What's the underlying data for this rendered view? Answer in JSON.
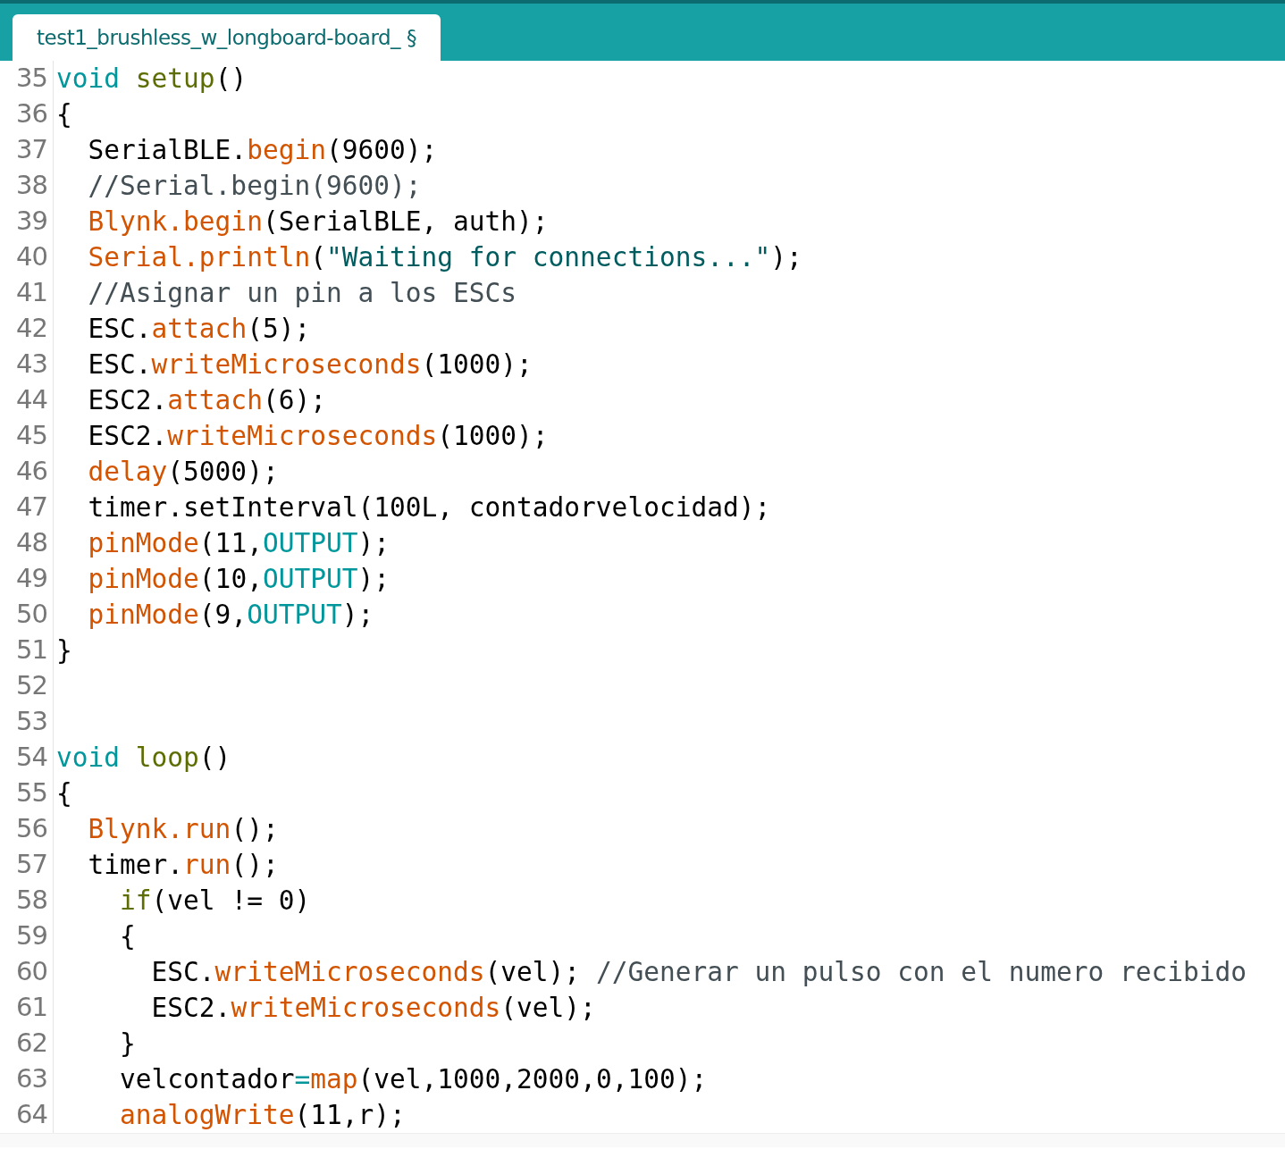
{
  "tabs": [
    {
      "label": "test1_brushless_w_longboard-board_ §",
      "selected": true
    }
  ],
  "lines": [
    {
      "number": "35",
      "tokens": [
        {
          "kind": "keyword",
          "text": "void"
        },
        {
          "kind": "name",
          "text": " setup"
        },
        {
          "kind": "plain",
          "text": "()"
        }
      ]
    },
    {
      "number": "36",
      "tokens": [
        {
          "kind": "plain",
          "text": "{"
        }
      ]
    },
    {
      "number": "37",
      "tokens": [
        {
          "kind": "plain",
          "text": "  SerialBLE."
        },
        {
          "kind": "function",
          "text": "begin"
        },
        {
          "kind": "plain",
          "text": "(9600);"
        }
      ]
    },
    {
      "number": "38",
      "tokens": [
        {
          "kind": "comment",
          "text": "  //Serial.begin(9600);"
        }
      ]
    },
    {
      "number": "39",
      "tokens": [
        {
          "kind": "function",
          "text": "  Blynk.begin"
        },
        {
          "kind": "plain",
          "text": "(SerialBLE, auth);"
        }
      ]
    },
    {
      "number": "40",
      "tokens": [
        {
          "kind": "function",
          "text": "  Serial.println"
        },
        {
          "kind": "plain",
          "text": "("
        },
        {
          "kind": "string",
          "text": "\"Waiting for connections...\""
        },
        {
          "kind": "plain",
          "text": ");"
        }
      ]
    },
    {
      "number": "41",
      "tokens": [
        {
          "kind": "comment",
          "text": "  //Asignar un pin a los ESCs"
        }
      ]
    },
    {
      "number": "42",
      "tokens": [
        {
          "kind": "plain",
          "text": "  ESC."
        },
        {
          "kind": "function",
          "text": "attach"
        },
        {
          "kind": "plain",
          "text": "(5);"
        }
      ]
    },
    {
      "number": "43",
      "tokens": [
        {
          "kind": "plain",
          "text": "  ESC."
        },
        {
          "kind": "function",
          "text": "writeMicroseconds"
        },
        {
          "kind": "plain",
          "text": "(1000);"
        }
      ]
    },
    {
      "number": "44",
      "tokens": [
        {
          "kind": "plain",
          "text": "  ESC2."
        },
        {
          "kind": "function",
          "text": "attach"
        },
        {
          "kind": "plain",
          "text": "(6);"
        }
      ]
    },
    {
      "number": "45",
      "tokens": [
        {
          "kind": "plain",
          "text": "  ESC2."
        },
        {
          "kind": "function",
          "text": "writeMicroseconds"
        },
        {
          "kind": "plain",
          "text": "(1000);"
        }
      ]
    },
    {
      "number": "46",
      "tokens": [
        {
          "kind": "function",
          "text": "  delay"
        },
        {
          "kind": "plain",
          "text": "(5000);"
        }
      ]
    },
    {
      "number": "47",
      "tokens": [
        {
          "kind": "plain",
          "text": "  timer.setInterval(100L, contadorvelocidad);"
        }
      ]
    },
    {
      "number": "48",
      "tokens": [
        {
          "kind": "function",
          "text": "  pinMode"
        },
        {
          "kind": "plain",
          "text": "(11,"
        },
        {
          "kind": "keyword",
          "text": "OUTPUT"
        },
        {
          "kind": "plain",
          "text": ");"
        }
      ]
    },
    {
      "number": "49",
      "tokens": [
        {
          "kind": "function",
          "text": "  pinMode"
        },
        {
          "kind": "plain",
          "text": "(10,"
        },
        {
          "kind": "keyword",
          "text": "OUTPUT"
        },
        {
          "kind": "plain",
          "text": ");"
        }
      ]
    },
    {
      "number": "50",
      "tokens": [
        {
          "kind": "function",
          "text": "  pinMode"
        },
        {
          "kind": "plain",
          "text": "(9,"
        },
        {
          "kind": "keyword",
          "text": "OUTPUT"
        },
        {
          "kind": "plain",
          "text": ");"
        }
      ]
    },
    {
      "number": "51",
      "tokens": [
        {
          "kind": "plain",
          "text": "}"
        }
      ]
    },
    {
      "number": "52"
    },
    {
      "number": "53"
    },
    {
      "number": "54",
      "tokens": [
        {
          "kind": "keyword",
          "text": "void"
        },
        {
          "kind": "name",
          "text": " loop"
        },
        {
          "kind": "plain",
          "text": "()"
        }
      ]
    },
    {
      "number": "55",
      "tokens": [
        {
          "kind": "plain",
          "text": "{"
        }
      ]
    },
    {
      "number": "56",
      "tokens": [
        {
          "kind": "function",
          "text": "  Blynk.run"
        },
        {
          "kind": "plain",
          "text": "();"
        }
      ]
    },
    {
      "number": "57",
      "tokens": [
        {
          "kind": "plain",
          "text": "  timer."
        },
        {
          "kind": "function",
          "text": "run"
        },
        {
          "kind": "plain",
          "text": "();"
        }
      ]
    },
    {
      "number": "58",
      "tokens": [
        {
          "kind": "name",
          "text": "    if"
        },
        {
          "kind": "plain",
          "text": "(vel != 0)"
        }
      ]
    },
    {
      "number": "59",
      "tokens": [
        {
          "kind": "plain",
          "text": "    {"
        }
      ]
    },
    {
      "number": "60",
      "tokens": [
        {
          "kind": "plain",
          "text": "      ESC."
        },
        {
          "kind": "function",
          "text": "writeMicroseconds"
        },
        {
          "kind": "plain",
          "text": "(vel); "
        },
        {
          "kind": "comment",
          "text": "//Generar un pulso con el numero recibido"
        }
      ]
    },
    {
      "number": "61",
      "tokens": [
        {
          "kind": "plain",
          "text": "      ESC2."
        },
        {
          "kind": "function",
          "text": "writeMicroseconds"
        },
        {
          "kind": "plain",
          "text": "(vel);"
        }
      ]
    },
    {
      "number": "62",
      "tokens": [
        {
          "kind": "plain",
          "text": "    }"
        }
      ]
    },
    {
      "number": "63",
      "tokens": [
        {
          "kind": "plain",
          "text": "    velcontador"
        },
        {
          "kind": "keyword",
          "text": "="
        },
        {
          "kind": "function",
          "text": "map"
        },
        {
          "kind": "plain",
          "text": "(vel,1000,2000,0,100);"
        }
      ]
    },
    {
      "number": "64",
      "tokens": [
        {
          "kind": "function",
          "text": "    analogWrite"
        },
        {
          "kind": "plain",
          "text": "(11,r);"
        }
      ]
    }
  ]
}
